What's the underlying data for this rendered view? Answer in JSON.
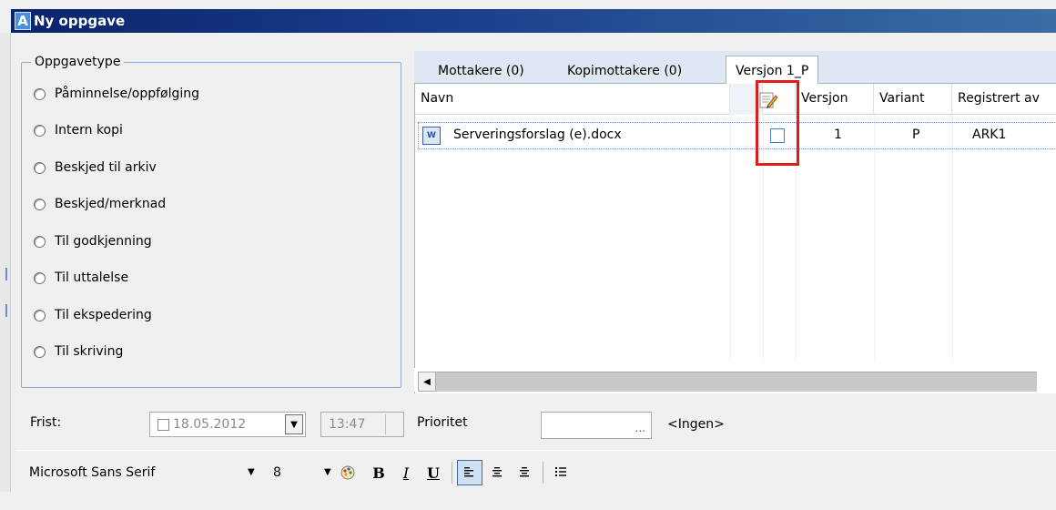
{
  "window": {
    "title": "Ny oppgave",
    "icon": "A"
  },
  "task_type": {
    "legend": "Oppgavetype",
    "options": [
      "Påminnelse/oppfølging",
      "Intern kopi",
      "Beskjed til arkiv",
      "Beskjed/merknad",
      "Til godkjenning",
      "Til uttalelse",
      "Til ekspedering",
      "Til skriving"
    ]
  },
  "tabs": [
    {
      "label": "Mottakere (0)"
    },
    {
      "label": "Kopimottakere (0)"
    },
    {
      "label": "Versjon 1_P"
    }
  ],
  "grid": {
    "headers": {
      "name": "Navn",
      "version": "Versjon",
      "variant": "Variant",
      "registered_by": "Registrert av"
    },
    "rows": [
      {
        "name": "Serveringsforslag (e).docx",
        "version": "1",
        "variant": "P",
        "registered_by": "ARK1",
        "checked": false
      }
    ]
  },
  "deadline": {
    "label": "Frist:",
    "date": "18.05.2012",
    "time": "13:47"
  },
  "priority": {
    "label": "Prioritet",
    "value": "<Ingen>",
    "button": "..."
  },
  "toolbar": {
    "font": "Microsoft Sans Serif",
    "size": "8",
    "bold": "B",
    "italic": "I",
    "underline": "U"
  },
  "colors": {
    "title_bar": "#0a246a",
    "highlight": "#e01b1b",
    "tab_area": "#dfe7f3"
  }
}
